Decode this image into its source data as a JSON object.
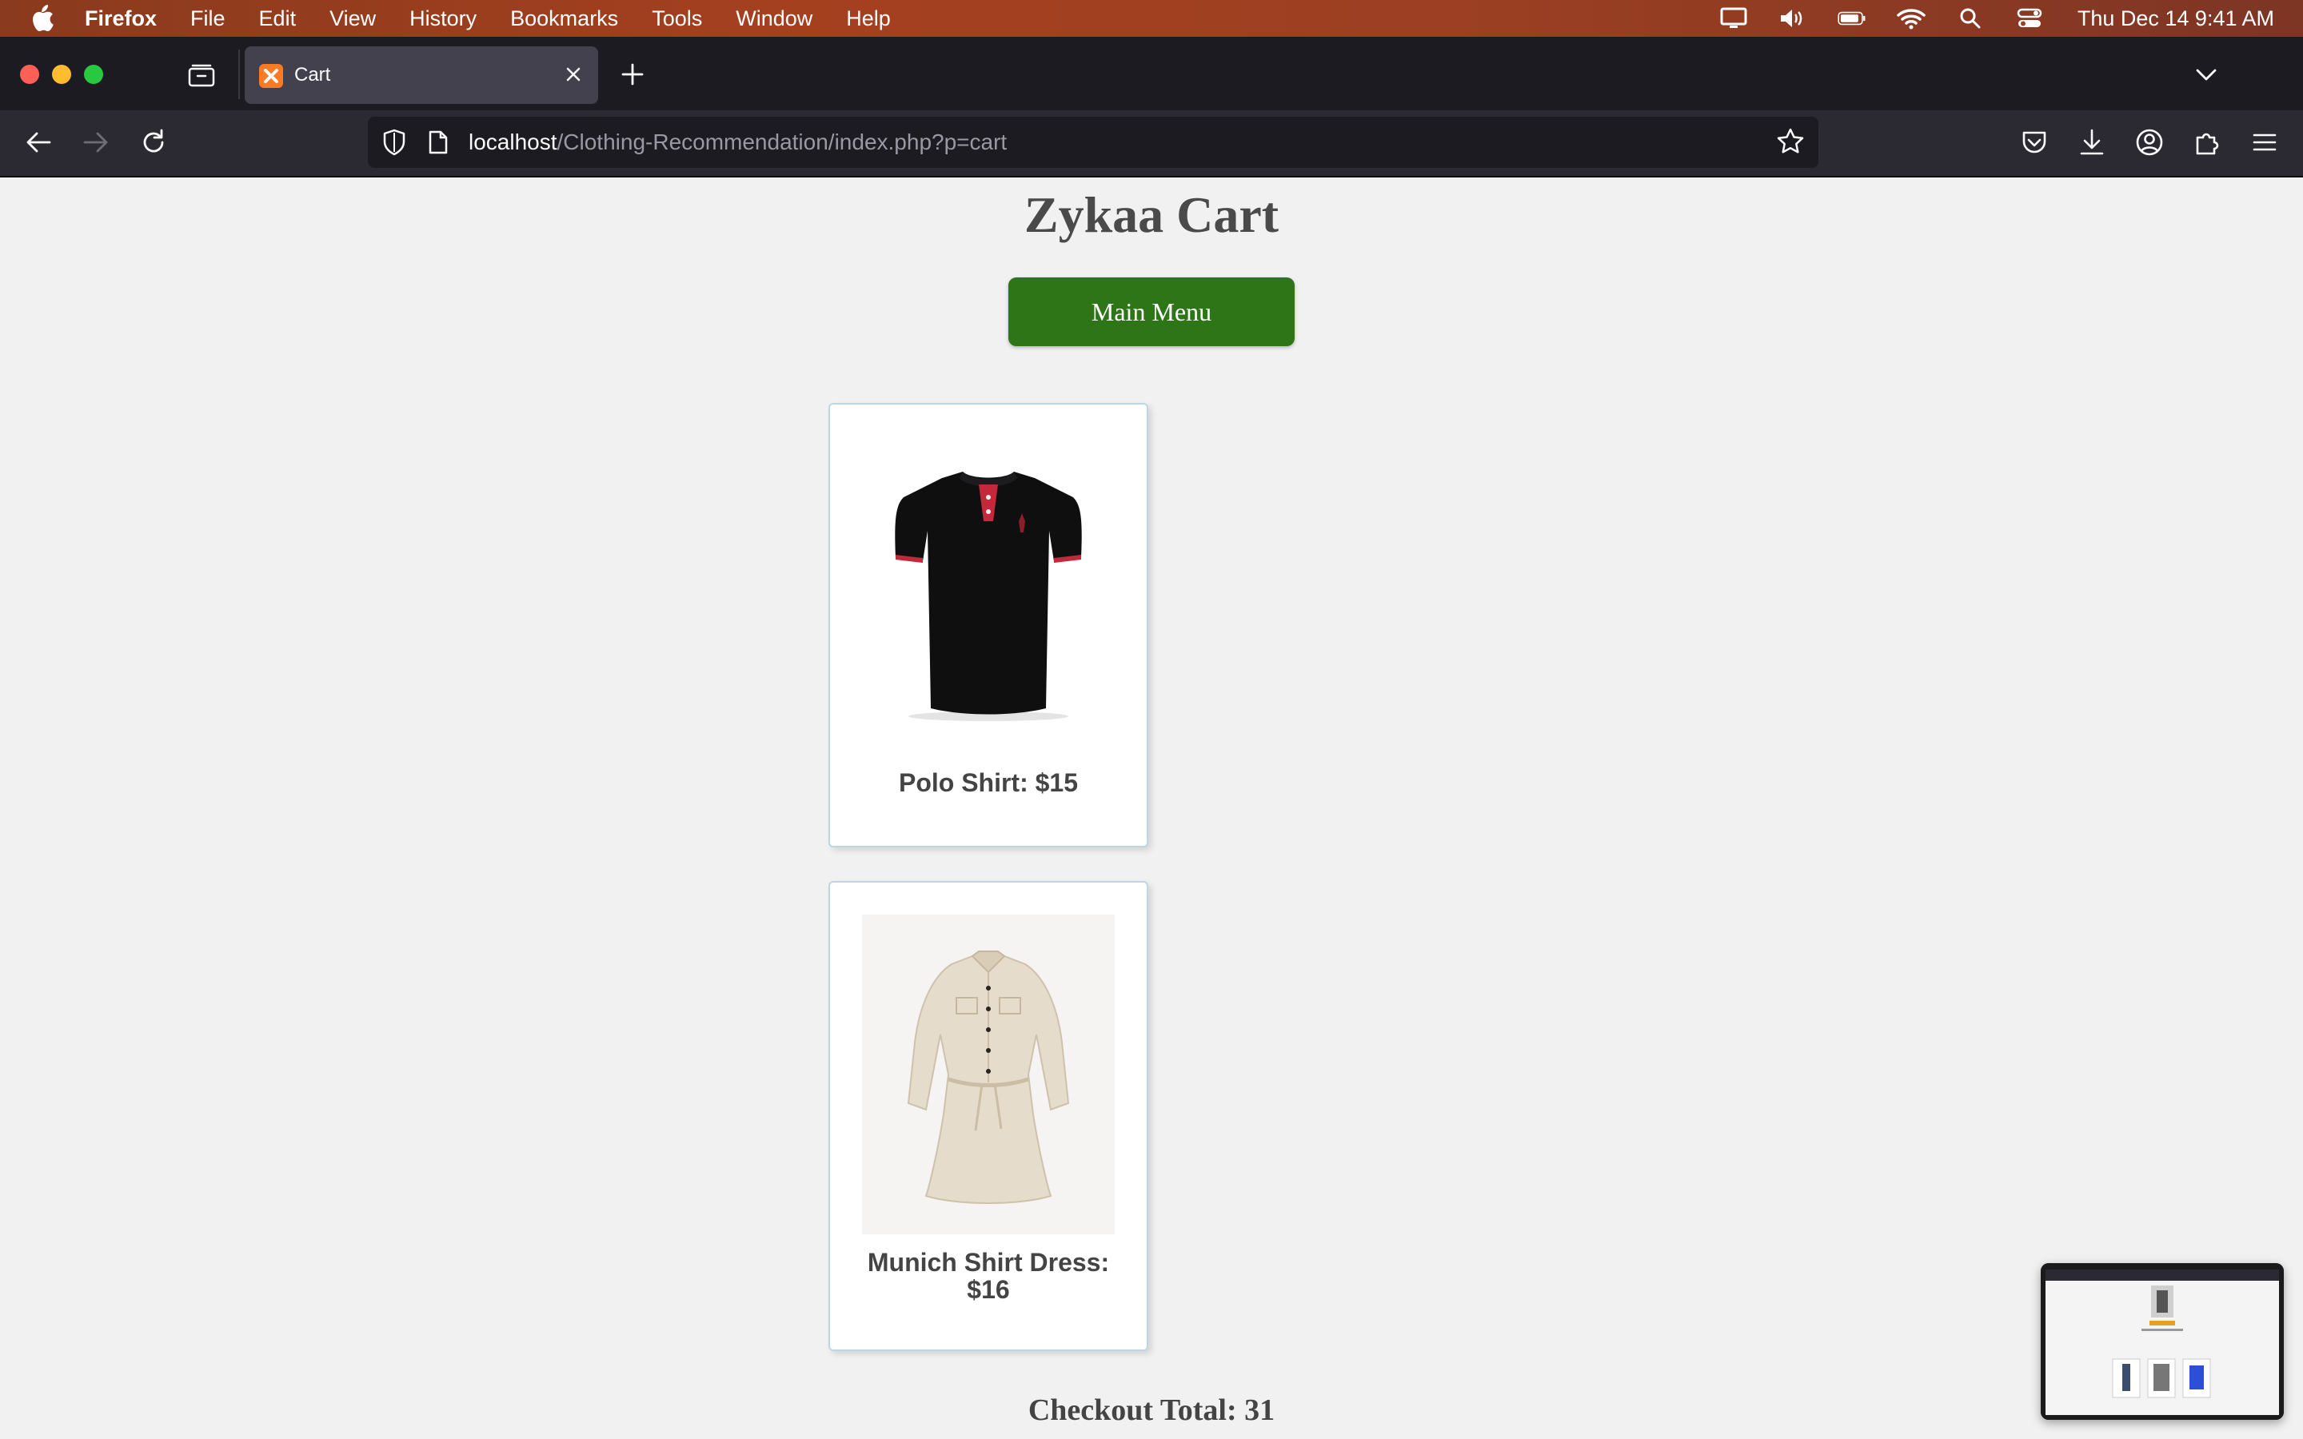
{
  "menubar": {
    "app_name": "Firefox",
    "items": [
      "File",
      "Edit",
      "View",
      "History",
      "Bookmarks",
      "Tools",
      "Window",
      "Help"
    ],
    "clock": "Thu Dec 14  9:41 AM"
  },
  "browser": {
    "tab_title": "Cart",
    "url_host": "localhost",
    "url_path": "/Clothing-Recommendation/index.php?p=cart"
  },
  "page": {
    "title": "Zykaa Cart",
    "main_menu_label": "Main Menu",
    "items": [
      {
        "label": "Polo Shirt: $15"
      },
      {
        "label": "Munich Shirt Dress: $16"
      }
    ],
    "checkout_total": "Checkout Total: 31"
  },
  "colors": {
    "button_green": "#2e7517",
    "page_background": "#f1f1f1",
    "card_border": "#bcd6e6"
  },
  "icons": [
    "apple-icon",
    "display-icon",
    "volume-icon",
    "battery-icon",
    "wifi-icon",
    "search-icon",
    "control-center-icon",
    "tab-overview-icon",
    "close-icon",
    "plus-icon",
    "chevron-down-icon",
    "back-icon",
    "forward-icon",
    "reload-icon",
    "shield-icon",
    "page-icon",
    "star-icon",
    "pocket-icon",
    "download-icon",
    "account-icon",
    "extensions-icon",
    "hamburger-menu-icon"
  ]
}
